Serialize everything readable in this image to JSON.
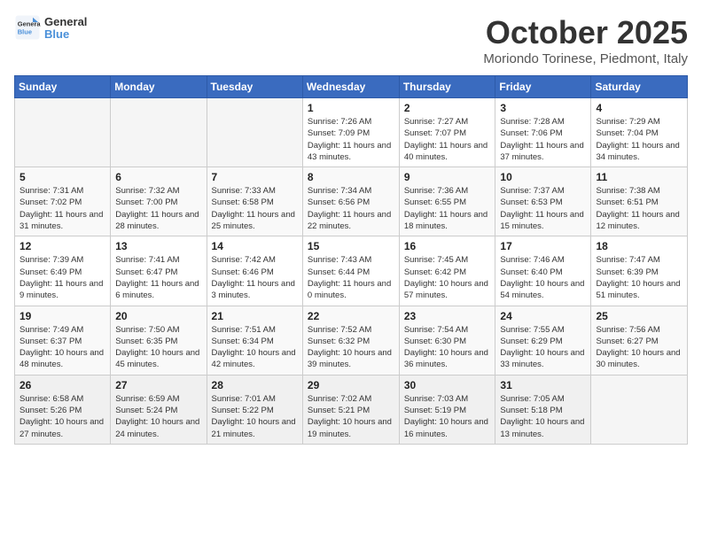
{
  "header": {
    "logo_general": "General",
    "logo_blue": "Blue",
    "month": "October 2025",
    "location": "Moriondo Torinese, Piedmont, Italy"
  },
  "weekdays": [
    "Sunday",
    "Monday",
    "Tuesday",
    "Wednesday",
    "Thursday",
    "Friday",
    "Saturday"
  ],
  "weeks": [
    [
      {
        "day": "",
        "info": ""
      },
      {
        "day": "",
        "info": ""
      },
      {
        "day": "",
        "info": ""
      },
      {
        "day": "1",
        "info": "Sunrise: 7:26 AM\nSunset: 7:09 PM\nDaylight: 11 hours and 43 minutes."
      },
      {
        "day": "2",
        "info": "Sunrise: 7:27 AM\nSunset: 7:07 PM\nDaylight: 11 hours and 40 minutes."
      },
      {
        "day": "3",
        "info": "Sunrise: 7:28 AM\nSunset: 7:06 PM\nDaylight: 11 hours and 37 minutes."
      },
      {
        "day": "4",
        "info": "Sunrise: 7:29 AM\nSunset: 7:04 PM\nDaylight: 11 hours and 34 minutes."
      }
    ],
    [
      {
        "day": "5",
        "info": "Sunrise: 7:31 AM\nSunset: 7:02 PM\nDaylight: 11 hours and 31 minutes."
      },
      {
        "day": "6",
        "info": "Sunrise: 7:32 AM\nSunset: 7:00 PM\nDaylight: 11 hours and 28 minutes."
      },
      {
        "day": "7",
        "info": "Sunrise: 7:33 AM\nSunset: 6:58 PM\nDaylight: 11 hours and 25 minutes."
      },
      {
        "day": "8",
        "info": "Sunrise: 7:34 AM\nSunset: 6:56 PM\nDaylight: 11 hours and 22 minutes."
      },
      {
        "day": "9",
        "info": "Sunrise: 7:36 AM\nSunset: 6:55 PM\nDaylight: 11 hours and 18 minutes."
      },
      {
        "day": "10",
        "info": "Sunrise: 7:37 AM\nSunset: 6:53 PM\nDaylight: 11 hours and 15 minutes."
      },
      {
        "day": "11",
        "info": "Sunrise: 7:38 AM\nSunset: 6:51 PM\nDaylight: 11 hours and 12 minutes."
      }
    ],
    [
      {
        "day": "12",
        "info": "Sunrise: 7:39 AM\nSunset: 6:49 PM\nDaylight: 11 hours and 9 minutes."
      },
      {
        "day": "13",
        "info": "Sunrise: 7:41 AM\nSunset: 6:47 PM\nDaylight: 11 hours and 6 minutes."
      },
      {
        "day": "14",
        "info": "Sunrise: 7:42 AM\nSunset: 6:46 PM\nDaylight: 11 hours and 3 minutes."
      },
      {
        "day": "15",
        "info": "Sunrise: 7:43 AM\nSunset: 6:44 PM\nDaylight: 11 hours and 0 minutes."
      },
      {
        "day": "16",
        "info": "Sunrise: 7:45 AM\nSunset: 6:42 PM\nDaylight: 10 hours and 57 minutes."
      },
      {
        "day": "17",
        "info": "Sunrise: 7:46 AM\nSunset: 6:40 PM\nDaylight: 10 hours and 54 minutes."
      },
      {
        "day": "18",
        "info": "Sunrise: 7:47 AM\nSunset: 6:39 PM\nDaylight: 10 hours and 51 minutes."
      }
    ],
    [
      {
        "day": "19",
        "info": "Sunrise: 7:49 AM\nSunset: 6:37 PM\nDaylight: 10 hours and 48 minutes."
      },
      {
        "day": "20",
        "info": "Sunrise: 7:50 AM\nSunset: 6:35 PM\nDaylight: 10 hours and 45 minutes."
      },
      {
        "day": "21",
        "info": "Sunrise: 7:51 AM\nSunset: 6:34 PM\nDaylight: 10 hours and 42 minutes."
      },
      {
        "day": "22",
        "info": "Sunrise: 7:52 AM\nSunset: 6:32 PM\nDaylight: 10 hours and 39 minutes."
      },
      {
        "day": "23",
        "info": "Sunrise: 7:54 AM\nSunset: 6:30 PM\nDaylight: 10 hours and 36 minutes."
      },
      {
        "day": "24",
        "info": "Sunrise: 7:55 AM\nSunset: 6:29 PM\nDaylight: 10 hours and 33 minutes."
      },
      {
        "day": "25",
        "info": "Sunrise: 7:56 AM\nSunset: 6:27 PM\nDaylight: 10 hours and 30 minutes."
      }
    ],
    [
      {
        "day": "26",
        "info": "Sunrise: 6:58 AM\nSunset: 5:26 PM\nDaylight: 10 hours and 27 minutes."
      },
      {
        "day": "27",
        "info": "Sunrise: 6:59 AM\nSunset: 5:24 PM\nDaylight: 10 hours and 24 minutes."
      },
      {
        "day": "28",
        "info": "Sunrise: 7:01 AM\nSunset: 5:22 PM\nDaylight: 10 hours and 21 minutes."
      },
      {
        "day": "29",
        "info": "Sunrise: 7:02 AM\nSunset: 5:21 PM\nDaylight: 10 hours and 19 minutes."
      },
      {
        "day": "30",
        "info": "Sunrise: 7:03 AM\nSunset: 5:19 PM\nDaylight: 10 hours and 16 minutes."
      },
      {
        "day": "31",
        "info": "Sunrise: 7:05 AM\nSunset: 5:18 PM\nDaylight: 10 hours and 13 minutes."
      },
      {
        "day": "",
        "info": ""
      }
    ]
  ]
}
